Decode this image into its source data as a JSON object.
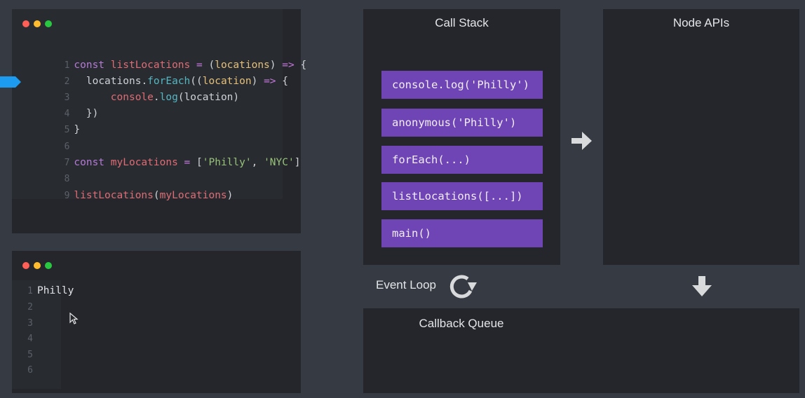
{
  "editor": {
    "current_line": 3,
    "lines": [
      {
        "n": "1",
        "t": "const listLocations = (locations) => {"
      },
      {
        "n": "2",
        "t": "  locations.forEach((location) => {"
      },
      {
        "n": "3",
        "t": "      console.log(location)"
      },
      {
        "n": "4",
        "t": "  })"
      },
      {
        "n": "5",
        "t": "}"
      },
      {
        "n": "6",
        "t": ""
      },
      {
        "n": "7",
        "t": "const myLocations = ['Philly', 'NYC']"
      },
      {
        "n": "8",
        "t": ""
      },
      {
        "n": "9",
        "t": "listLocations(myLocations)"
      }
    ]
  },
  "console": {
    "lines": [
      {
        "n": "1",
        "t": "Philly"
      },
      {
        "n": "2",
        "t": ""
      },
      {
        "n": "3",
        "t": ""
      },
      {
        "n": "4",
        "t": ""
      },
      {
        "n": "5",
        "t": ""
      },
      {
        "n": "6",
        "t": ""
      }
    ]
  },
  "call_stack": {
    "title": "Call Stack",
    "frames": [
      "console.log('Philly')",
      "anonymous('Philly')",
      "forEach(...)",
      "listLocations([...])",
      "main()"
    ]
  },
  "node_apis": {
    "title": "Node APIs"
  },
  "event_loop": {
    "label": "Event Loop"
  },
  "callback_queue": {
    "title": "Callback Queue"
  },
  "colors": {
    "background": "#363a42",
    "panel": "#24262b",
    "stack_frame": "#6f44b4",
    "line_pointer": "#1d9bf0"
  },
  "icons": [
    "right-arrow-icon",
    "down-arrow-icon",
    "refresh-loop-icon",
    "mouse-cursor-icon",
    "window-dots-icon"
  ]
}
